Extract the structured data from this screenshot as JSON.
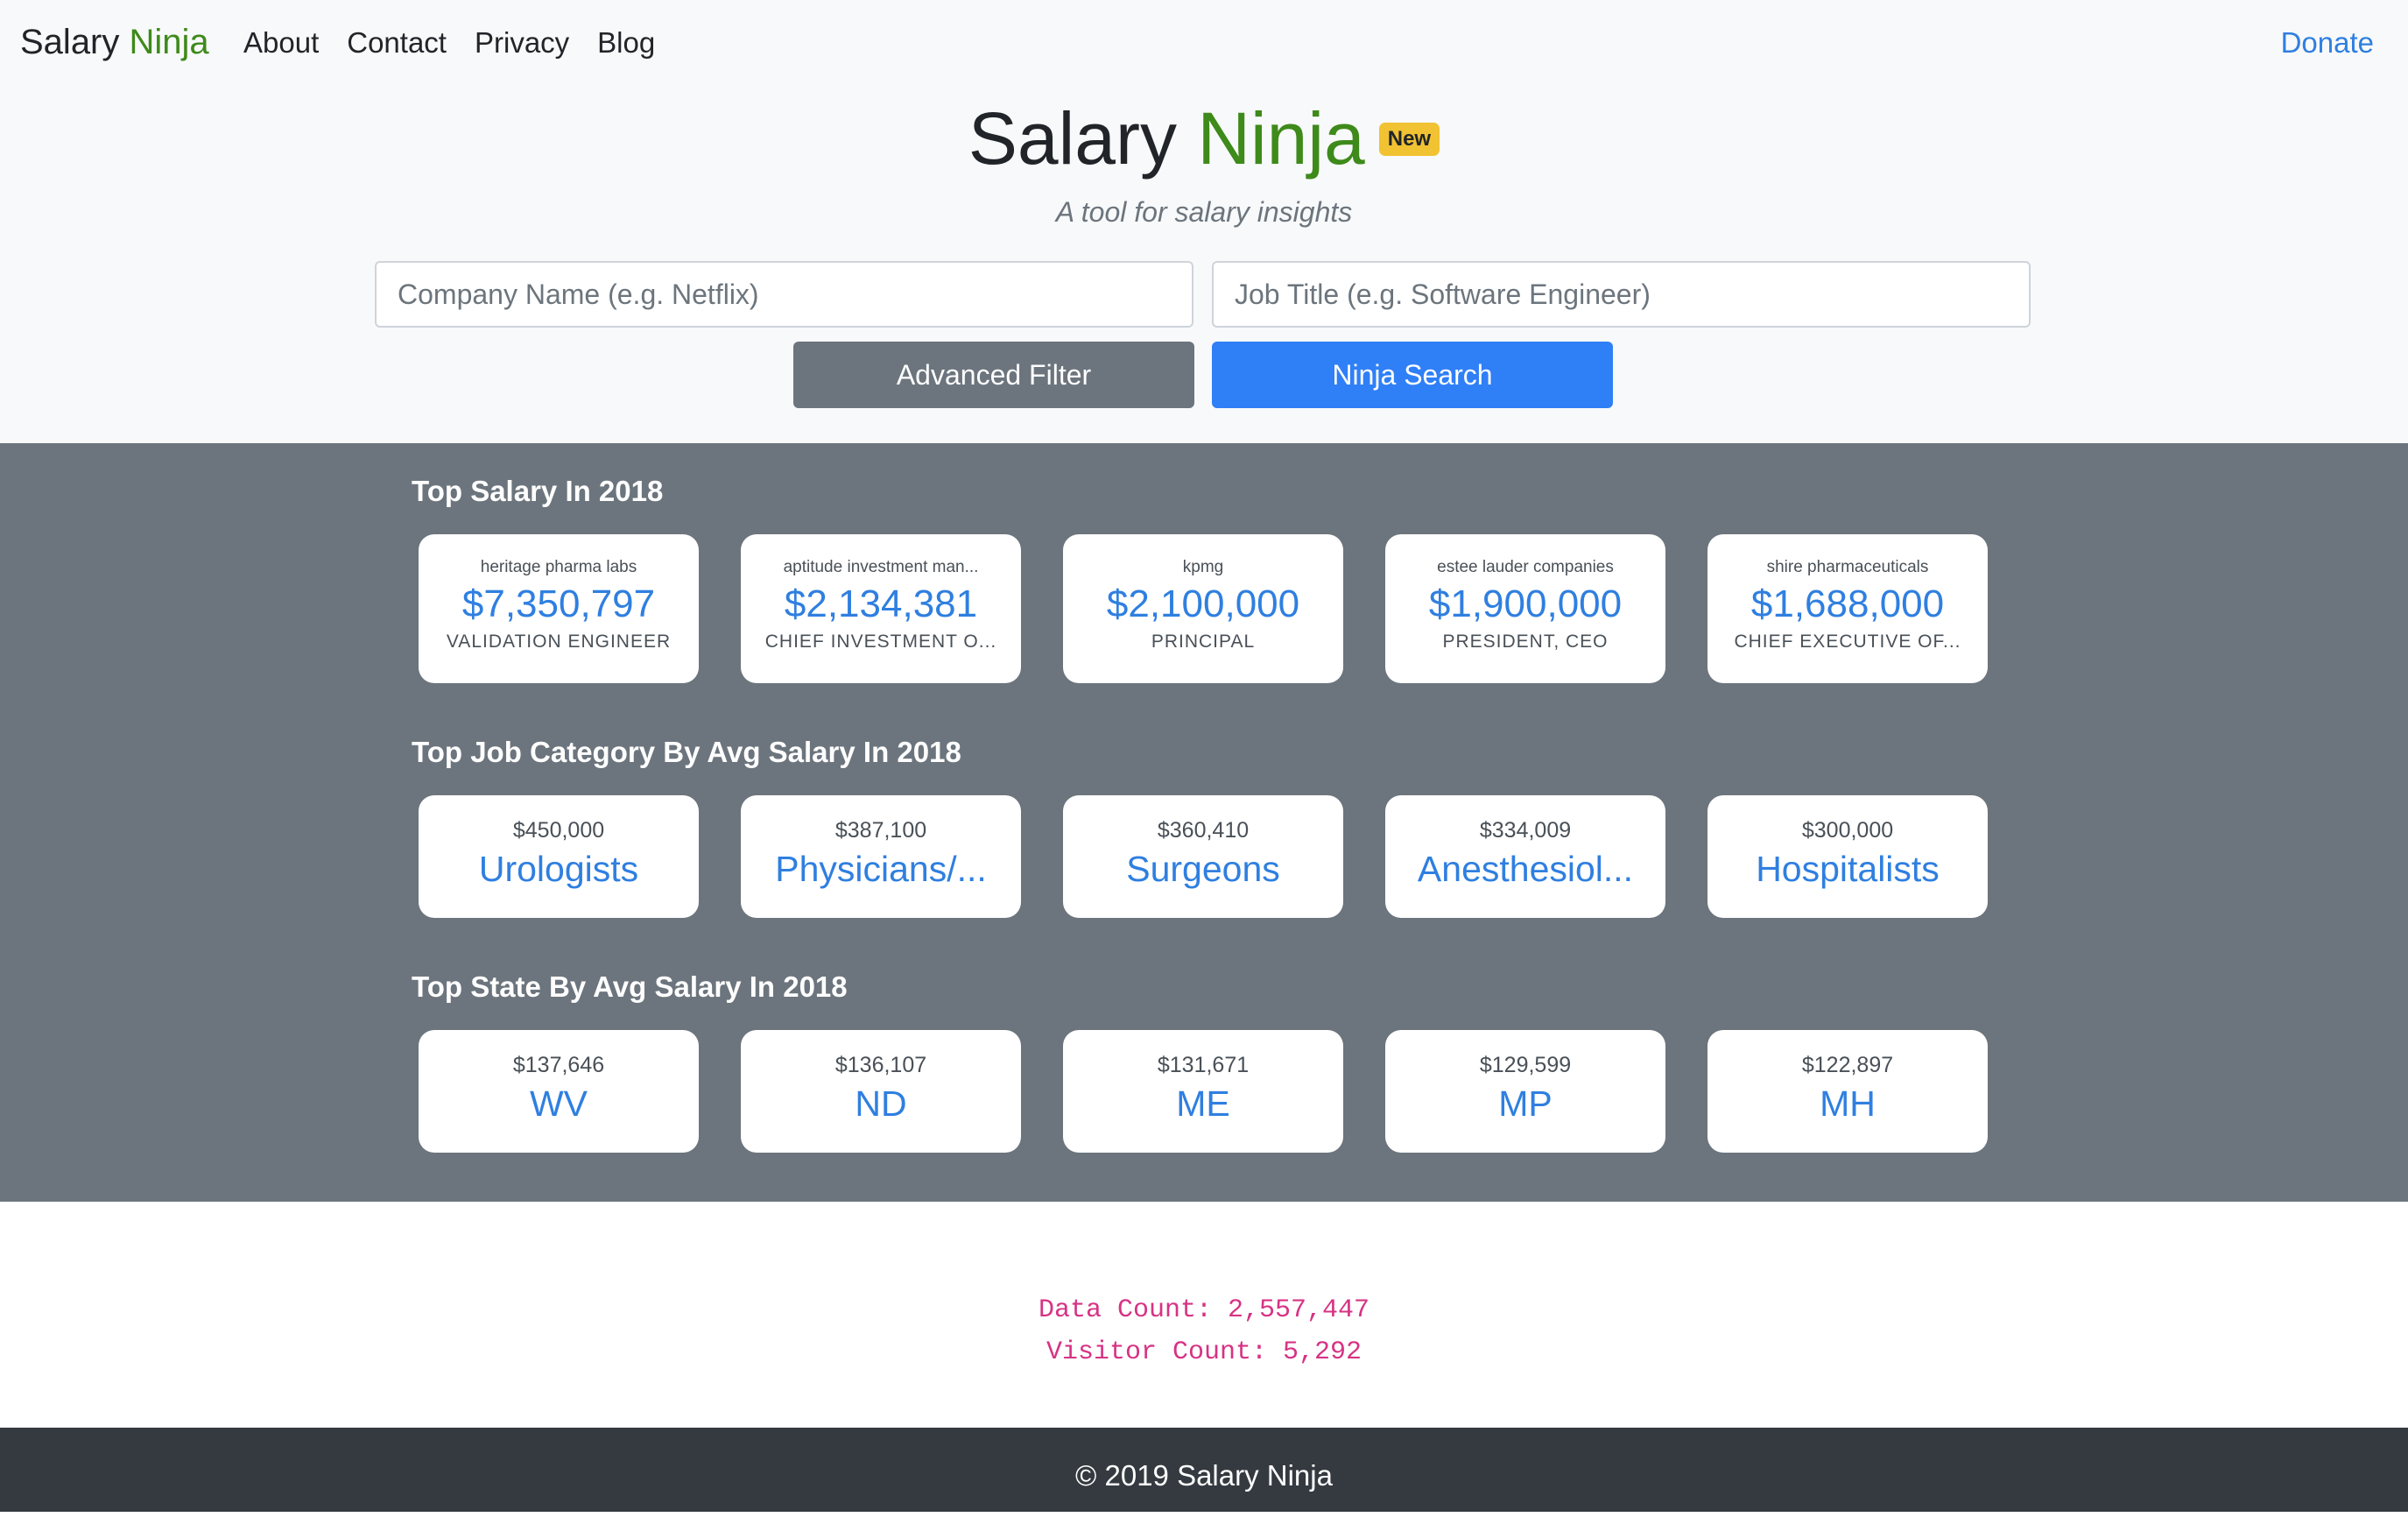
{
  "navbar": {
    "brand": "Salary",
    "brand_accent": "Ninja",
    "links": [
      "About",
      "Contact",
      "Privacy",
      "Blog"
    ],
    "donate": "Donate"
  },
  "hero": {
    "title": "Salary",
    "title_accent": "Ninja",
    "badge": "New",
    "subtitle": "A tool for salary insights",
    "company_placeholder": "Company Name (e.g. Netflix)",
    "job_placeholder": "Job Title (e.g. Software Engineer)",
    "advanced_filter": "Advanced Filter",
    "search": "Ninja Search"
  },
  "top_salary": {
    "title": "Top Salary In 2018",
    "items": [
      {
        "company": "heritage pharma labs",
        "amount": "$7,350,797",
        "role": "VALIDATION ENGINEER"
      },
      {
        "company": "aptitude investment man...",
        "amount": "$2,134,381",
        "role": "CHIEF INVESTMENT O..."
      },
      {
        "company": "kpmg",
        "amount": "$2,100,000",
        "role": "PRINCIPAL"
      },
      {
        "company": "estee lauder companies",
        "amount": "$1,900,000",
        "role": "PRESIDENT, CEO"
      },
      {
        "company": "shire pharmaceuticals",
        "amount": "$1,688,000",
        "role": "CHIEF EXECUTIVE OF..."
      }
    ]
  },
  "top_category": {
    "title": "Top Job Category By Avg Salary In 2018",
    "items": [
      {
        "avg": "$450,000",
        "label": "Urologists"
      },
      {
        "avg": "$387,100",
        "label": "Physicians/..."
      },
      {
        "avg": "$360,410",
        "label": "Surgeons"
      },
      {
        "avg": "$334,009",
        "label": "Anesthesiol..."
      },
      {
        "avg": "$300,000",
        "label": "Hospitalists"
      }
    ]
  },
  "top_state": {
    "title": "Top State By Avg Salary In 2018",
    "items": [
      {
        "avg": "$137,646",
        "label": "WV"
      },
      {
        "avg": "$136,107",
        "label": "ND"
      },
      {
        "avg": "$131,671",
        "label": "ME"
      },
      {
        "avg": "$129,599",
        "label": "MP"
      },
      {
        "avg": "$122,897",
        "label": "MH"
      }
    ]
  },
  "counts": {
    "data_count": "Data Count: 2,557,447",
    "visitor_count": "Visitor Count: 5,292"
  },
  "footer": {
    "text": "© 2019 Salary Ninja"
  }
}
